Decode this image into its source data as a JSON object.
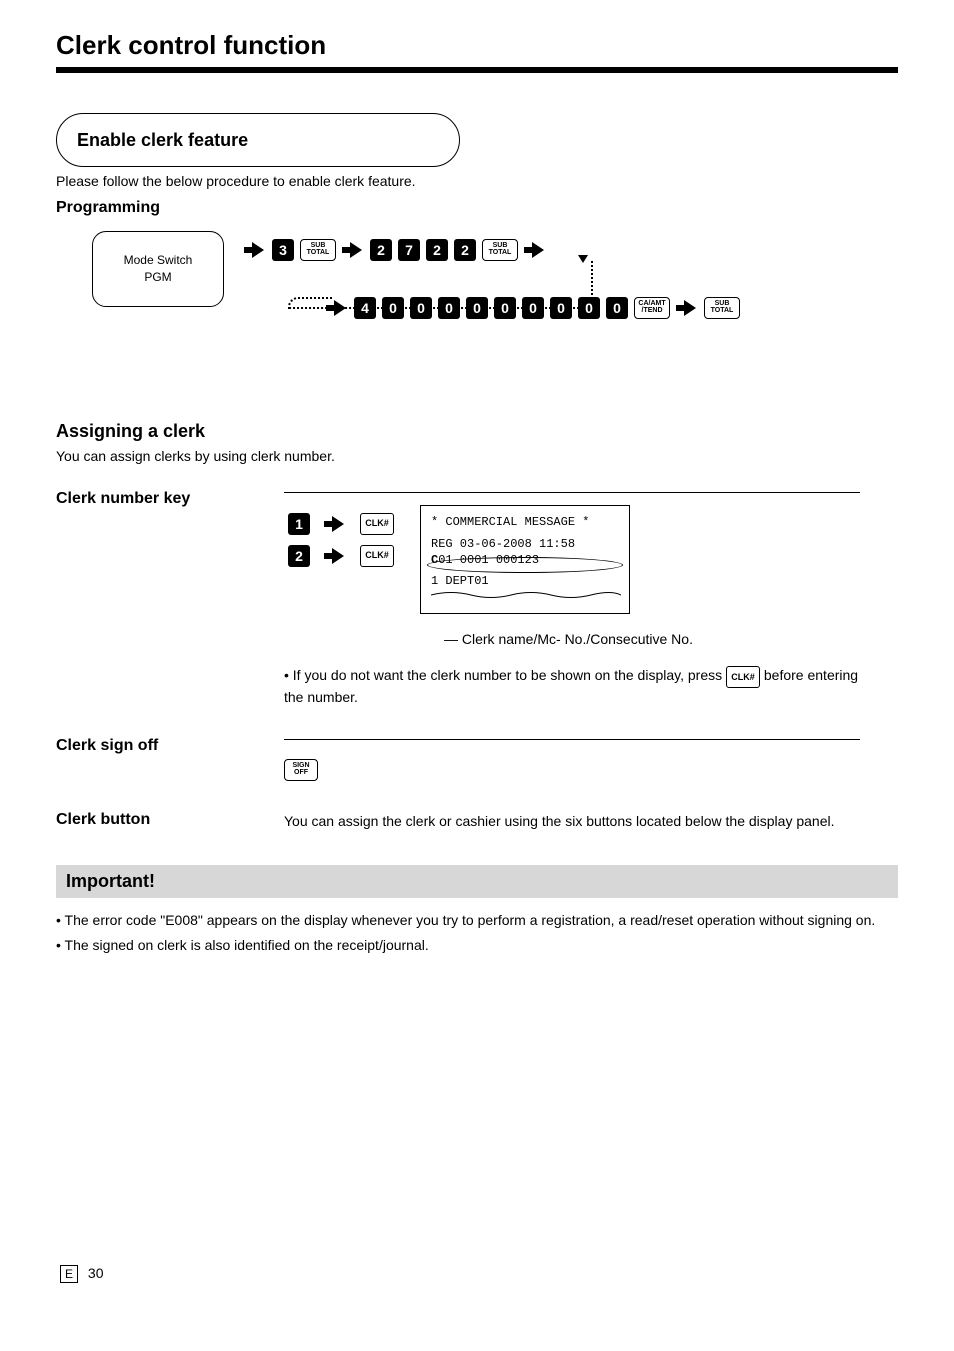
{
  "section_title": "Clerk control function",
  "bubble_title": "Enable clerk feature",
  "intro_para": "Please follow the below procedure to enable clerk feature.",
  "prog_heading": "Programming",
  "pgmblock_line1": "Mode Switch",
  "pgmblock_line2": "PGM",
  "seq": {
    "row1_first_num": "3",
    "subtotal_top": "SUB",
    "subtotal_bot": "TOTAL",
    "row1_second": [
      "2",
      "7",
      "2",
      "2"
    ],
    "row2_nums": [
      "4",
      "0",
      "0",
      "0",
      "0",
      "0",
      "0",
      "0",
      "0",
      "0"
    ],
    "caamt_top": "CA/AMT",
    "caamt_bot": "/TEND"
  },
  "assign_heading": "Assigning a clerk",
  "assign_para": "You can assign clerks by using clerk number.",
  "clknum_heading": "Clerk number key",
  "clerk_row1_num": "1",
  "clerk_row2_num": "2",
  "clk_label": "CLK#",
  "receipt": {
    "l1": "*  COMMERCIAL MESSAGE  *",
    "l2": "REG  03-06-2008 11:58",
    "l3a": "C",
    "l3b": "01     0001     000123",
    "l4": " 1 DEPT01"
  },
  "clerk_note": "Clerk name/Mc- No./Consecutive No.",
  "signoff_heading": "Clerk sign off",
  "signoff_key_top": "SIGN",
  "signoff_key_bot": "OFF",
  "nopress_text_1": "•  If you do not want the clerk number to be shown on the display, press ",
  "nopress_text_2": " before entering the number.",
  "twocol_label": "Clerk button",
  "twocol_body": "You can assign the clerk or cashier using the six buttons located below the display panel.",
  "graybar_text": "Important!",
  "gray_body_1": "•  The error code \"E008\" appears on the display whenever you try to perform a registration, a read/reset operation without signing on.",
  "gray_body_2": "•  The signed on clerk is also identified on the receipt/journal.",
  "page_number": "30",
  "page_label": "E"
}
